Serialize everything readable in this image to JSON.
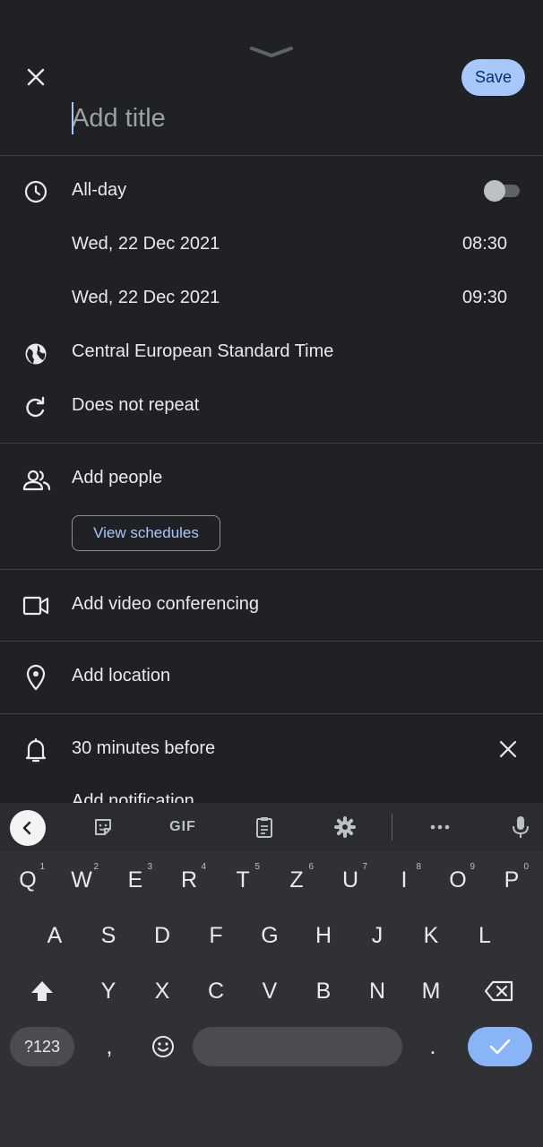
{
  "header": {
    "save_label": "Save",
    "title_placeholder": "Add title"
  },
  "datetime": {
    "all_day_label": "All-day",
    "all_day_enabled": false,
    "start_date": "Wed, 22 Dec 2021",
    "start_time": "08:30",
    "end_date": "Wed, 22 Dec 2021",
    "end_time": "09:30",
    "timezone": "Central European Standard Time",
    "repeat": "Does not repeat"
  },
  "people": {
    "label": "Add people",
    "view_schedules_label": "View schedules"
  },
  "conferencing": {
    "label": "Add video conferencing"
  },
  "location": {
    "label": "Add location"
  },
  "notifications": {
    "reminder": "30 minutes before",
    "add_label": "Add notification"
  },
  "keyboard": {
    "row1": [
      {
        "key": "Q",
        "hint": "1"
      },
      {
        "key": "W",
        "hint": "2"
      },
      {
        "key": "E",
        "hint": "3"
      },
      {
        "key": "R",
        "hint": "4"
      },
      {
        "key": "T",
        "hint": "5"
      },
      {
        "key": "Z",
        "hint": "6"
      },
      {
        "key": "U",
        "hint": "7"
      },
      {
        "key": "I",
        "hint": "8"
      },
      {
        "key": "O",
        "hint": "9"
      },
      {
        "key": "P",
        "hint": "0"
      }
    ],
    "row2": [
      "A",
      "S",
      "D",
      "F",
      "G",
      "H",
      "J",
      "K",
      "L"
    ],
    "row3": [
      "Y",
      "X",
      "C",
      "V",
      "B",
      "N",
      "M"
    ],
    "symbols_label": "?123",
    "comma": ",",
    "period": ".",
    "gif_label": "GIF"
  },
  "colors": {
    "background": "#202124",
    "accent": "#a8c7fa",
    "keyboard_bg": "#303134",
    "enter_key": "#8ab4f8"
  }
}
